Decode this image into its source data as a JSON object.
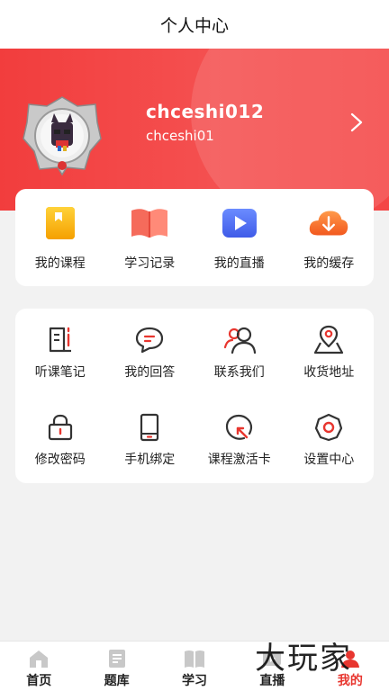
{
  "header": {
    "title": "个人中心"
  },
  "profile": {
    "username": "chceshi012",
    "subname": "chceshi01",
    "avatar_icon": "avatar-badge-icon"
  },
  "quick_actions": [
    {
      "label": "我的课程",
      "icon": "course-book-icon"
    },
    {
      "label": "学习记录",
      "icon": "open-book-icon"
    },
    {
      "label": "我的直播",
      "icon": "play-video-icon"
    },
    {
      "label": "我的缓存",
      "icon": "cloud-download-icon"
    }
  ],
  "services": [
    {
      "label": "听课笔记",
      "icon": "notes-icon"
    },
    {
      "label": "我的回答",
      "icon": "chat-bubble-icon"
    },
    {
      "label": "联系我们",
      "icon": "contacts-icon"
    },
    {
      "label": "收货地址",
      "icon": "location-pin-icon"
    },
    {
      "label": "修改密码",
      "icon": "lock-icon"
    },
    {
      "label": "手机绑定",
      "icon": "phone-icon"
    },
    {
      "label": "课程激活卡",
      "icon": "activation-icon"
    },
    {
      "label": "设置中心",
      "icon": "gear-icon"
    }
  ],
  "tabbar": {
    "items": [
      {
        "label": "首页",
        "icon": "home-icon"
      },
      {
        "label": "题库",
        "icon": "question-bank-icon"
      },
      {
        "label": "学习",
        "icon": "study-book-icon"
      },
      {
        "label": "直播",
        "icon": "live-icon"
      },
      {
        "label": "我的",
        "icon": "profile-icon"
      }
    ],
    "active": "我的"
  },
  "watermark": "大玩家",
  "colors": {
    "accent": "#e8362f",
    "hero": "#f23d3d"
  }
}
